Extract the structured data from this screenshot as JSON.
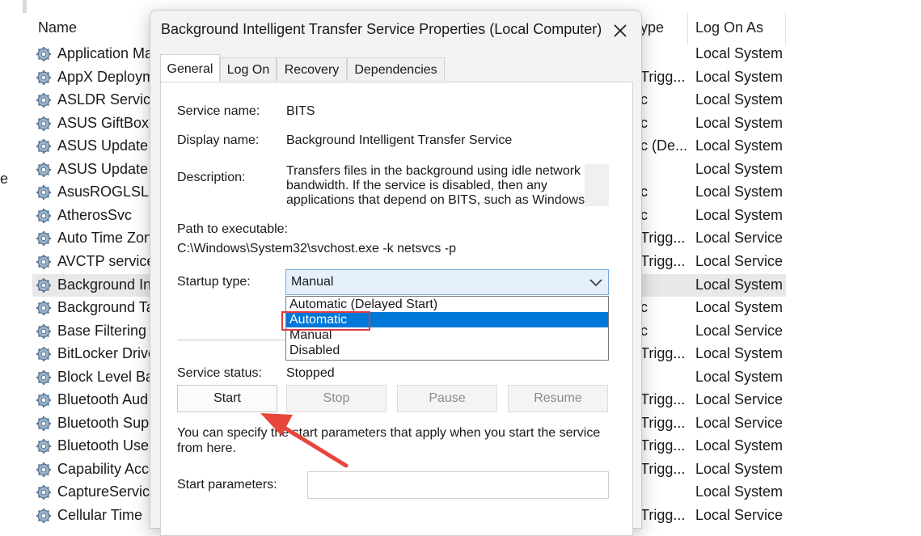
{
  "columns": {
    "name": "Name",
    "startup_type_partial": "ype",
    "log_on_as": "Log On As"
  },
  "left_edge_fragment": "e",
  "services": [
    {
      "name": "Application Ma",
      "type": "",
      "logon": "Local System"
    },
    {
      "name": "AppX Deploym",
      "type": "Trigg...",
      "logon": "Local System"
    },
    {
      "name": "ASLDR Service",
      "type": "c",
      "logon": "Local System"
    },
    {
      "name": "ASUS GiftBox S",
      "type": "c",
      "logon": "Local System"
    },
    {
      "name": "ASUS Update S",
      "type": "c (De...",
      "logon": "Local System"
    },
    {
      "name": "ASUS Update S",
      "type": "",
      "logon": "Local System"
    },
    {
      "name": "AsusROGLSLSe",
      "type": "c",
      "logon": "Local System"
    },
    {
      "name": "AtherosSvc",
      "type": "c",
      "logon": "Local System"
    },
    {
      "name": "Auto Time Zon",
      "type": "Trigg...",
      "logon": "Local Service"
    },
    {
      "name": "AVCTP service",
      "type": "Trigg...",
      "logon": "Local Service"
    },
    {
      "name": "Background In",
      "type": "",
      "logon": "Local System",
      "selected": true
    },
    {
      "name": "Background Ta",
      "type": "c",
      "logon": "Local System"
    },
    {
      "name": "Base Filtering E",
      "type": "c",
      "logon": "Local Service"
    },
    {
      "name": "BitLocker Drive",
      "type": "Trigg...",
      "logon": "Local System"
    },
    {
      "name": "Block Level Bac",
      "type": "",
      "logon": "Local System"
    },
    {
      "name": "Bluetooth Aud",
      "type": "Trigg...",
      "logon": "Local Service"
    },
    {
      "name": "Bluetooth Supp",
      "type": "Trigg...",
      "logon": "Local Service"
    },
    {
      "name": "Bluetooth User",
      "type": "Trigg...",
      "logon": "Local System"
    },
    {
      "name": "Capability Acce",
      "type": "Trigg...",
      "logon": "Local System"
    },
    {
      "name": "CaptureService",
      "type": "",
      "logon": "Local System"
    },
    {
      "name": "Cellular Time",
      "type": "Trigg...",
      "logon": "Local Service"
    }
  ],
  "dialog": {
    "title": "Background Intelligent Transfer Service Properties (Local Computer)",
    "close_icon": "close-icon",
    "tabs": [
      "General",
      "Log On",
      "Recovery",
      "Dependencies"
    ],
    "active_tab": "General",
    "service_name_label": "Service name:",
    "service_name": "BITS",
    "display_name_label": "Display name:",
    "display_name": "Background Intelligent Transfer Service",
    "description_label": "Description:",
    "description": "Transfers files in the background using idle network bandwidth. If the service is disabled, then any applications that depend on BITS, such as Windows",
    "path_label": "Path to executable:",
    "path": "C:\\Windows\\System32\\svchost.exe -k netsvcs -p",
    "startup_type_label": "Startup type:",
    "startup_type_value": "Manual",
    "startup_options": [
      "Automatic (Delayed Start)",
      "Automatic",
      "Manual",
      "Disabled"
    ],
    "highlighted_option": "Automatic",
    "service_status_label": "Service status:",
    "service_status": "Stopped",
    "buttons": {
      "start": "Start",
      "stop": "Stop",
      "pause": "Pause",
      "resume": "Resume"
    },
    "hint": "You can specify the start parameters that apply when you start the service from here.",
    "start_parameters_label": "Start parameters:",
    "start_parameters_value": ""
  },
  "colors": {
    "highlight_box": "#e0393e",
    "arrow": "#e8453c",
    "selection": "#0078d7"
  }
}
